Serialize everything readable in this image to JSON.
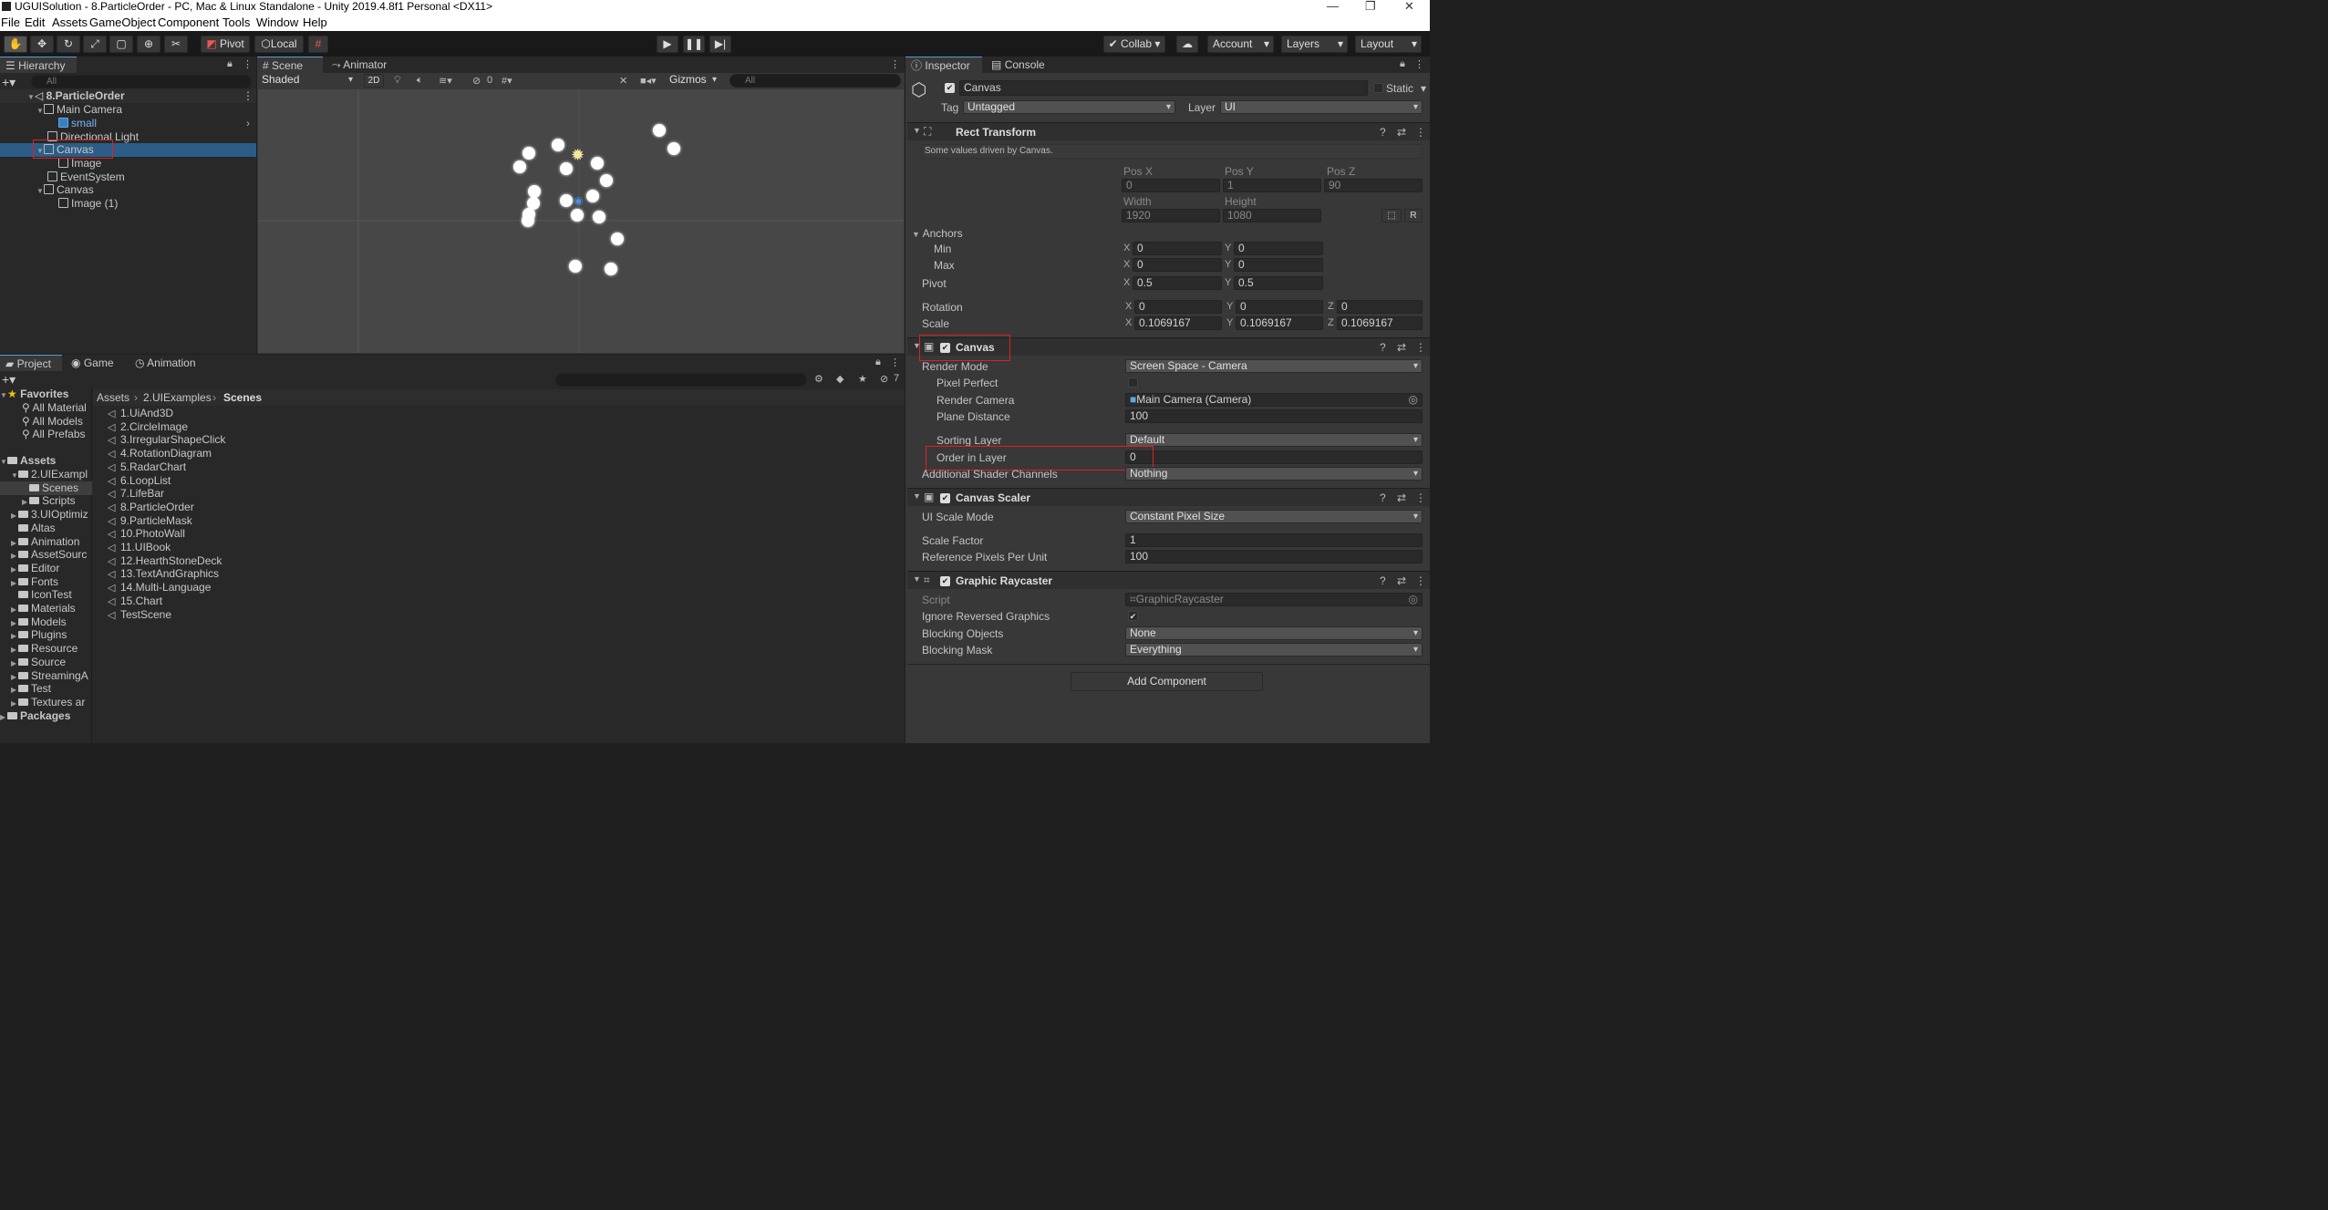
{
  "window": {
    "title": "UGUISolution - 8.ParticleOrder - PC, Mac & Linux Standalone - Unity 2019.4.8f1 Personal <DX11>"
  },
  "menu": [
    "File",
    "Edit",
    "Assets",
    "GameObject",
    "Component",
    "Tools",
    "Window",
    "Help"
  ],
  "toolbar": {
    "pivot": "Pivot",
    "local": "Local",
    "collab": "Collab",
    "account": "Account",
    "layers": "Layers",
    "layout": "Layout"
  },
  "hierarchy": {
    "tab": "Hierarchy",
    "search_placeholder": "All",
    "scene": "8.ParticleOrder",
    "items": [
      "Main Camera",
      "small",
      "Directional Light",
      "Canvas",
      "Image",
      "EventSystem",
      "Canvas",
      "Image (1)"
    ]
  },
  "scene": {
    "tabs": [
      "Scene",
      "Animator"
    ],
    "shading": "Shaded",
    "mode2d": "2D",
    "hidden_count": "0",
    "gizmos": "Gizmos",
    "search_placeholder": "All"
  },
  "project": {
    "tabs": [
      "Project",
      "Game",
      "Animation"
    ],
    "hidden_count": "7",
    "breadcrumb": [
      "Assets",
      "2.UIExamples",
      "Scenes"
    ],
    "favorites": "Favorites",
    "favorite_items": [
      "All Material",
      "All Models",
      "All Prefabs"
    ],
    "assets_root": "Assets",
    "tree": [
      "2.UIExampl",
      "Scenes",
      "Scripts",
      "3.UIOptimiz",
      "Altas",
      "Animation",
      "AssetSourc",
      "Editor",
      "Fonts",
      "IconTest",
      "Materials",
      "Models",
      "Plugins",
      "Resource",
      "Source",
      "StreamingA",
      "Test",
      "Textures ar"
    ],
    "packages": "Packages",
    "scenes": [
      "1.UiAnd3D",
      "2.CircleImage",
      "3.IrregularShapeClick",
      "4.RotationDiagram",
      "5.RadarChart",
      "6.LoopList",
      "7.LifeBar",
      "8.ParticleOrder",
      "9.ParticleMask",
      "10.PhotoWall",
      "11.UIBook",
      "12.HearthStoneDeck",
      "13.TextAndGraphics",
      "14.Multi-Language",
      "15.Chart",
      "TestScene"
    ]
  },
  "inspector": {
    "tabs": [
      "Inspector",
      "Console"
    ],
    "object_name": "Canvas",
    "static": "Static",
    "tag_label": "Tag",
    "tag": "Untagged",
    "layer_label": "Layer",
    "layer": "UI",
    "rect": {
      "title": "Rect Transform",
      "note": "Some values driven by Canvas.",
      "posx_l": "Pos X",
      "posy_l": "Pos Y",
      "posz_l": "Pos Z",
      "posx": "0",
      "posy": "1",
      "posz": "90",
      "width_l": "Width",
      "height_l": "Height",
      "width": "1920",
      "height": "1080",
      "anchors": "Anchors",
      "min": "Min",
      "max": "Max",
      "min_x": "0",
      "min_y": "0",
      "max_x": "0",
      "max_y": "0",
      "pivot": "Pivot",
      "pivot_x": "0.5",
      "pivot_y": "0.5",
      "rotation": "Rotation",
      "rot_x": "0",
      "rot_y": "0",
      "rot_z": "0",
      "scale": "Scale",
      "scale_x": "0.1069167",
      "scale_y": "0.1069167",
      "scale_z": "0.1069167"
    },
    "canvas": {
      "title": "Canvas",
      "render_mode_l": "Render Mode",
      "render_mode": "Screen Space - Camera",
      "pixel_perfect_l": "Pixel Perfect",
      "render_camera_l": "Render Camera",
      "render_camera": "Main Camera (Camera)",
      "plane_distance_l": "Plane Distance",
      "plane_distance": "100",
      "sorting_layer_l": "Sorting Layer",
      "sorting_layer": "Default",
      "order_l": "Order in Layer",
      "order": "0",
      "shader_l": "Additional Shader Channels",
      "shader": "Nothing"
    },
    "scaler": {
      "title": "Canvas Scaler",
      "mode_l": "UI Scale Mode",
      "mode": "Constant Pixel Size",
      "factor_l": "Scale Factor",
      "factor": "1",
      "ppu_l": "Reference Pixels Per Unit",
      "ppu": "100"
    },
    "raycaster": {
      "title": "Graphic Raycaster",
      "script_l": "Script",
      "script": "GraphicRaycaster",
      "ignore_l": "Ignore Reversed Graphics",
      "blocking_l": "Blocking Objects",
      "blocking": "None",
      "mask_l": "Blocking Mask",
      "mask": "Everything"
    },
    "add_component": "Add Component"
  },
  "colors": {
    "accent": "#2c5d87",
    "highlight": "#e02020"
  }
}
